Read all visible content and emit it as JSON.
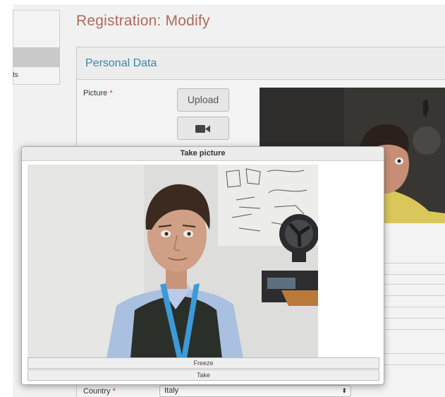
{
  "page": {
    "title": "Registration: Modify",
    "side_menu_fragment": "ts"
  },
  "panel": {
    "title": "Personal Data",
    "picture_label": "Picture",
    "required_mark": "*",
    "upload_label": "Upload",
    "camera_icon": "video-camera-icon"
  },
  "country": {
    "label": "Country",
    "required_mark": "*",
    "selected": "Italy",
    "arrows": "⬍"
  },
  "modal": {
    "title": "Take picture",
    "freeze_label": "Freeze",
    "take_label": "Take"
  },
  "colors": {
    "title_accent": "#b06a5c",
    "panel_title": "#3a86a4",
    "required": "#c0392b",
    "lanyard": "#3d9ad8"
  }
}
